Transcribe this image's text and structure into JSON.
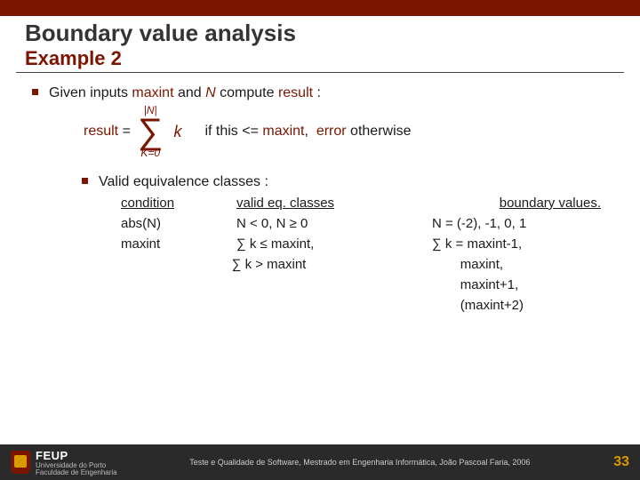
{
  "title": "Boundary value analysis",
  "subtitle": "Example 2",
  "line1": {
    "prefix": "Given inputs ",
    "maxint": "maxint",
    "and": " and ",
    "N": "N",
    "suffix": " compute ",
    "result": "result",
    "colon": " :"
  },
  "formula": {
    "lhs_result": "result",
    "lhs_eq": " =",
    "upper": "|N|",
    "sigma": "∑",
    "lower": "K=0",
    "k": "k",
    "rhs_if": "if this <= ",
    "rhs_maxint": "maxint",
    "rhs_comma": ", ",
    "rhs_error": "error",
    "rhs_otherwise": " otherwise"
  },
  "sub_heading": "Valid equivalence classes :",
  "table": {
    "h1": "condition",
    "h2": "valid eq. classes",
    "h3": "boundary values.",
    "r1c1": "abs(N)",
    "r1c2a": "N < 0,   ",
    "r1c2b": "N ≥ 0",
    "r1c3": "N = (-2), -1, 0, 1",
    "r2c1": "maxint",
    "r2c2": "∑ k  ≤  maxint,",
    "r2c3": "∑ k  =  maxint-1,",
    "r3c2": "∑ k  >  maxint",
    "r3c3": "maxint,",
    "r4c3": "maxint+1,",
    "r5c3": "(maxint+2)"
  },
  "footer": {
    "org_main": "FEUP",
    "org_sub1": "Universidade do Porto",
    "org_sub2": "Faculdade de Engenharia",
    "credit": "Teste e Qualidade de Software, Mestrado em Engenharia Informática, João Pascoal Faria, 2006",
    "page": "33"
  }
}
